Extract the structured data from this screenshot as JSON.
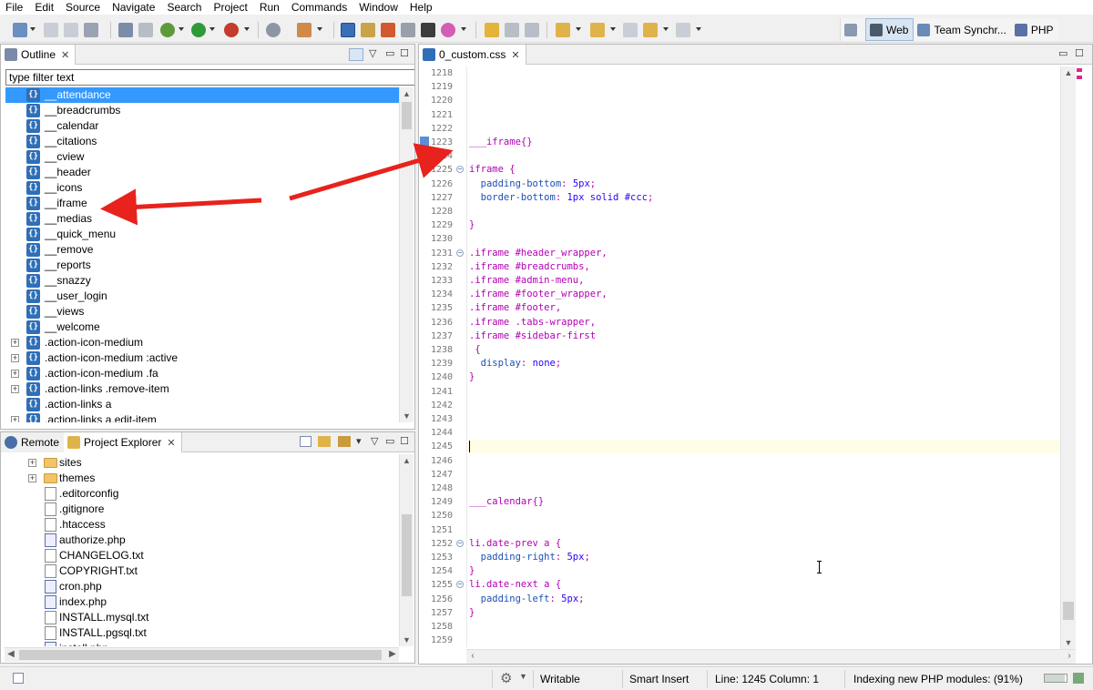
{
  "menu": [
    "File",
    "Edit",
    "Source",
    "Navigate",
    "Search",
    "Project",
    "Run",
    "Commands",
    "Window",
    "Help"
  ],
  "perspectives": [
    {
      "label": "",
      "icon": "open-perspective-icon"
    },
    {
      "label": "Web",
      "icon": "web-perspective-icon",
      "active": true
    },
    {
      "label": "Team Synchr...",
      "icon": "team-synchronize-icon"
    },
    {
      "label": "PHP",
      "icon": "php-perspective-icon"
    }
  ],
  "outline": {
    "tab_label": "Outline",
    "filter_value": "type filter text",
    "items": [
      {
        "label": "__attendance",
        "expandable": false,
        "selected": true
      },
      {
        "label": "__breadcrumbs",
        "expandable": false
      },
      {
        "label": "__calendar",
        "expandable": false
      },
      {
        "label": "__citations",
        "expandable": false
      },
      {
        "label": "__cview",
        "expandable": false
      },
      {
        "label": "__header",
        "expandable": false
      },
      {
        "label": "__icons",
        "expandable": false
      },
      {
        "label": "__iframe",
        "expandable": false
      },
      {
        "label": "__medias",
        "expandable": false
      },
      {
        "label": "__quick_menu",
        "expandable": false
      },
      {
        "label": "__remove",
        "expandable": false
      },
      {
        "label": "__reports",
        "expandable": false
      },
      {
        "label": "__snazzy",
        "expandable": false
      },
      {
        "label": "__user_login",
        "expandable": false
      },
      {
        "label": "__views",
        "expandable": false
      },
      {
        "label": "__welcome",
        "expandable": false
      },
      {
        "label": ".action-icon-medium",
        "expandable": true
      },
      {
        "label": ".action-icon-medium :active",
        "expandable": true
      },
      {
        "label": ".action-icon-medium .fa",
        "expandable": true
      },
      {
        "label": ".action-links .remove-item",
        "expandable": true
      },
      {
        "label": ".action-links a",
        "expandable": false
      },
      {
        "label": ".action-links a.edit-item",
        "expandable": true
      }
    ]
  },
  "explorer": {
    "tabs": [
      "Remote",
      "Project Explorer"
    ],
    "items": [
      {
        "label": "sites",
        "type": "folder",
        "expandable": true
      },
      {
        "label": "themes",
        "type": "folder",
        "expandable": true
      },
      {
        "label": ".editorconfig",
        "type": "file"
      },
      {
        "label": ".gitignore",
        "type": "file"
      },
      {
        "label": ".htaccess",
        "type": "file"
      },
      {
        "label": "authorize.php",
        "type": "php"
      },
      {
        "label": "CHANGELOG.txt",
        "type": "txt"
      },
      {
        "label": "COPYRIGHT.txt",
        "type": "txt"
      },
      {
        "label": "cron.php",
        "type": "php"
      },
      {
        "label": "index.php",
        "type": "php"
      },
      {
        "label": "INSTALL.mysql.txt",
        "type": "txt"
      },
      {
        "label": "INSTALL.pgsql.txt",
        "type": "txt"
      },
      {
        "label": "install.php",
        "type": "php"
      }
    ]
  },
  "editor": {
    "tab_label": "0_custom.css",
    "lines": [
      {
        "n": "1218",
        "code": []
      },
      {
        "n": "1219",
        "code": []
      },
      {
        "n": "1220",
        "code": []
      },
      {
        "n": "1221",
        "code": []
      },
      {
        "n": "1222",
        "code": []
      },
      {
        "n": "1223",
        "code": [
          {
            "t": "___iframe{}",
            "c": "c-cmt"
          }
        ],
        "marker": true
      },
      {
        "n": "1224",
        "code": []
      },
      {
        "n": "1225",
        "code": [
          {
            "t": "iframe {",
            "c": "c-sel"
          }
        ],
        "fold": true
      },
      {
        "n": "1226",
        "code": [
          {
            "t": "  padding-bottom",
            "c": "c-prop"
          },
          {
            "t": ": ",
            "c": "c-punc"
          },
          {
            "t": "5px",
            "c": "c-val"
          },
          {
            "t": ";",
            "c": "c-punc"
          }
        ]
      },
      {
        "n": "1227",
        "code": [
          {
            "t": "  border-bottom",
            "c": "c-prop"
          },
          {
            "t": ": ",
            "c": "c-punc"
          },
          {
            "t": "1px solid #ccc",
            "c": "c-val"
          },
          {
            "t": ";",
            "c": "c-punc"
          }
        ]
      },
      {
        "n": "1228",
        "code": []
      },
      {
        "n": "1229",
        "code": [
          {
            "t": "}",
            "c": "c-sel"
          }
        ]
      },
      {
        "n": "1230",
        "code": []
      },
      {
        "n": "1231",
        "code": [
          {
            "t": ".iframe #header_wrapper,",
            "c": "c-sel"
          }
        ],
        "fold": true
      },
      {
        "n": "1232",
        "code": [
          {
            "t": ".iframe #breadcrumbs,",
            "c": "c-sel"
          }
        ]
      },
      {
        "n": "1233",
        "code": [
          {
            "t": ".iframe #admin-menu,",
            "c": "c-sel"
          }
        ]
      },
      {
        "n": "1234",
        "code": [
          {
            "t": ".iframe #footer_wrapper,",
            "c": "c-sel"
          }
        ]
      },
      {
        "n": "1235",
        "code": [
          {
            "t": ".iframe #footer,",
            "c": "c-sel"
          }
        ]
      },
      {
        "n": "1236",
        "code": [
          {
            "t": ".iframe .tabs-wrapper,",
            "c": "c-sel"
          }
        ]
      },
      {
        "n": "1237",
        "code": [
          {
            "t": ".iframe #sidebar-first",
            "c": "c-sel"
          }
        ]
      },
      {
        "n": "1238",
        "code": [
          {
            "t": " {",
            "c": "c-sel"
          }
        ]
      },
      {
        "n": "1239",
        "code": [
          {
            "t": "  display",
            "c": "c-prop"
          },
          {
            "t": ": ",
            "c": "c-punc"
          },
          {
            "t": "none",
            "c": "c-val"
          },
          {
            "t": ";",
            "c": "c-punc"
          }
        ]
      },
      {
        "n": "1240",
        "code": [
          {
            "t": "}",
            "c": "c-sel"
          }
        ]
      },
      {
        "n": "1241",
        "code": []
      },
      {
        "n": "1242",
        "code": []
      },
      {
        "n": "1243",
        "code": []
      },
      {
        "n": "1244",
        "code": []
      },
      {
        "n": "1245",
        "code": [],
        "current": true
      },
      {
        "n": "1246",
        "code": []
      },
      {
        "n": "1247",
        "code": []
      },
      {
        "n": "1248",
        "code": []
      },
      {
        "n": "1249",
        "code": [
          {
            "t": "___calendar{}",
            "c": "c-cmt"
          }
        ]
      },
      {
        "n": "1250",
        "code": []
      },
      {
        "n": "1251",
        "code": []
      },
      {
        "n": "1252",
        "code": [
          {
            "t": "li.date-prev a {",
            "c": "c-sel"
          }
        ],
        "fold": true
      },
      {
        "n": "1253",
        "code": [
          {
            "t": "  padding-right",
            "c": "c-prop"
          },
          {
            "t": ": ",
            "c": "c-punc"
          },
          {
            "t": "5px",
            "c": "c-val"
          },
          {
            "t": ";",
            "c": "c-punc"
          }
        ]
      },
      {
        "n": "1254",
        "code": [
          {
            "t": "}",
            "c": "c-sel"
          }
        ]
      },
      {
        "n": "1255",
        "code": [
          {
            "t": "li.date-next a {",
            "c": "c-sel"
          }
        ],
        "fold": true
      },
      {
        "n": "1256",
        "code": [
          {
            "t": "  padding-left",
            "c": "c-prop"
          },
          {
            "t": ": ",
            "c": "c-punc"
          },
          {
            "t": "5px",
            "c": "c-val"
          },
          {
            "t": ";",
            "c": "c-punc"
          }
        ]
      },
      {
        "n": "1257",
        "code": [
          {
            "t": "}",
            "c": "c-sel"
          }
        ]
      },
      {
        "n": "1258",
        "code": []
      },
      {
        "n": "1259",
        "code": []
      }
    ]
  },
  "status": {
    "writable": "Writable",
    "insert_mode": "Smart Insert",
    "position": "Line: 1245 Column: 1",
    "indexing": "Indexing new PHP modules: (91%)",
    "indexing_progress": 0.91
  },
  "colors": {
    "selection": "#3399ff",
    "annotation_arrow": "#e8221c",
    "css_selector": "#b400b4",
    "css_property": "#1e50b4",
    "css_value": "#2a00ff"
  }
}
